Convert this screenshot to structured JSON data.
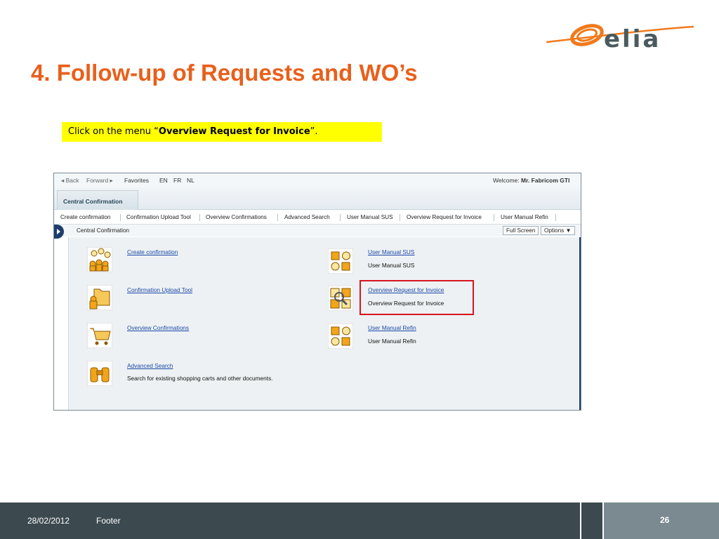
{
  "logo": {
    "text": "elia",
    "colors": {
      "swoosh": "#f07a1c",
      "text": "#4a5a5e"
    }
  },
  "slide": {
    "title": "4. Follow-up of Requests and WO’s",
    "instruction_prefix": "Click on the menu “",
    "instruction_bold": "Overview Request for Invoice",
    "instruction_suffix": "”."
  },
  "portal": {
    "topbar": {
      "back": "◂ Back",
      "forward": "Forward ▸",
      "favorites": "Favorites",
      "langs": [
        "EN",
        "FR",
        "NL"
      ],
      "welcome_label": "Welcome:",
      "welcome_user": "Mr. Fabricom GTI"
    },
    "active_tab": "Central Confirmation",
    "subnav": [
      "Create confirmation",
      "Confirmation Upload Tool",
      "Overview Confirmations",
      "Advanced Search",
      "User Manual SUS",
      "Overview Request for Invoice",
      "User Manual Refin"
    ],
    "breadcrumb": "Central Confirmation",
    "full_screen": "Full Screen",
    "options": "Options ▼",
    "left_items": [
      {
        "link": "Create confirmation",
        "desc": "",
        "icon": "people-group-icon"
      },
      {
        "link": "Confirmation Upload Tool",
        "desc": "",
        "icon": "folder-user-icon"
      },
      {
        "link": "Overview Confirmations",
        "desc": "",
        "icon": "shopping-cart-icon"
      },
      {
        "link": "Advanced Search",
        "desc": "Search for existing shopping carts and other documents.",
        "icon": "binoculars-icon"
      }
    ],
    "right_items": [
      {
        "link": "User Manual SUS",
        "desc": "User Manual SUS",
        "icon": "shapes-icon"
      },
      {
        "link": "Overview Request for Invoice",
        "desc": "Overview Request for Invoice",
        "icon": "search-people-icon"
      },
      {
        "link": "User Manual Refin",
        "desc": "User Manual Refin",
        "icon": "shapes-icon"
      }
    ]
  },
  "footer": {
    "date": "28/02/2012",
    "text": "Footer",
    "page": "26"
  },
  "colors": {
    "title": "#e8601c",
    "highlight": "#ffff00",
    "footer": "#3c4a50",
    "link": "#1a49a8",
    "callout": "#d6141f"
  }
}
